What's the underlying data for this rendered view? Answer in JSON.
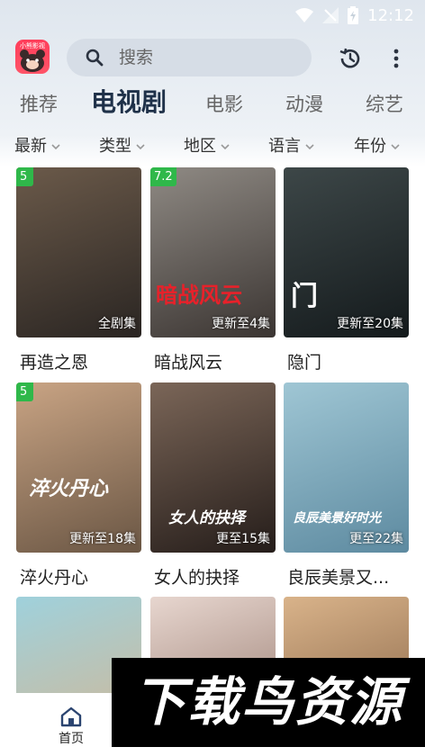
{
  "status_bar": {
    "time": "12:12"
  },
  "app": {
    "logo_text": "小熊影视"
  },
  "search": {
    "placeholder": "搜索"
  },
  "tabs": [
    {
      "label": "推荐",
      "active": false
    },
    {
      "label": "电视剧",
      "active": true
    },
    {
      "label": "电影",
      "active": false
    },
    {
      "label": "动漫",
      "active": false
    },
    {
      "label": "综艺",
      "active": false
    }
  ],
  "filters": [
    {
      "label": "最新"
    },
    {
      "label": "类型"
    },
    {
      "label": "地区"
    },
    {
      "label": "语言"
    },
    {
      "label": "年份"
    }
  ],
  "shows": [
    {
      "title": "再造之恩",
      "score": "5",
      "status": "全剧集",
      "poster_title": "",
      "colors": [
        "#6b5a4a",
        "#2a2522"
      ]
    },
    {
      "title": "暗战风云",
      "score": "7.2",
      "status": "更新至4集",
      "poster_title": "暗战风云",
      "colors": [
        "#8f8a84",
        "#3b3532"
      ]
    },
    {
      "title": "隐门",
      "score": "",
      "status": "更新至20集",
      "poster_title": "门",
      "colors": [
        "#3d4748",
        "#141a1c"
      ]
    },
    {
      "title": "淬火丹心",
      "score": "5",
      "status": "更新至18集",
      "poster_title": "淬火丹心",
      "colors": [
        "#c9a484",
        "#6a5644"
      ]
    },
    {
      "title": "女人的抉择",
      "score": "",
      "status": "更至15集",
      "poster_title": "女人的抉择",
      "colors": [
        "#7b6658",
        "#251d1a"
      ]
    },
    {
      "title": "良辰美景又...",
      "score": "",
      "status": "更至22集",
      "poster_title": "良辰美景好时光",
      "colors": [
        "#9fc6d4",
        "#5d8aa0"
      ]
    },
    {
      "title": "",
      "score": "",
      "status": "",
      "poster_title": "",
      "colors": [
        "#9fd1dc",
        "#d7b48e"
      ]
    },
    {
      "title": "",
      "score": "",
      "status": "",
      "poster_title": "",
      "colors": [
        "#e7d6cf",
        "#8d6f63"
      ]
    },
    {
      "title": "",
      "score": "",
      "status": "",
      "poster_title": "",
      "colors": [
        "#d9b38a",
        "#7c5a3e"
      ]
    }
  ],
  "bottom_nav": {
    "home_label": "首页"
  },
  "watermark": {
    "text": "下载鸟资源"
  },
  "icons": {
    "search": "search-icon",
    "history": "history-icon",
    "more": "more-vert-icon",
    "home": "home-icon",
    "chevron": "chevron-down-icon",
    "wifi": "wifi-icon",
    "no_signal": "no-signal-icon",
    "battery": "battery-charging-icon"
  },
  "colors": {
    "active_tab": "#1f3149",
    "score_badge": "#2fb84a",
    "logo": "#ff3d5a"
  }
}
